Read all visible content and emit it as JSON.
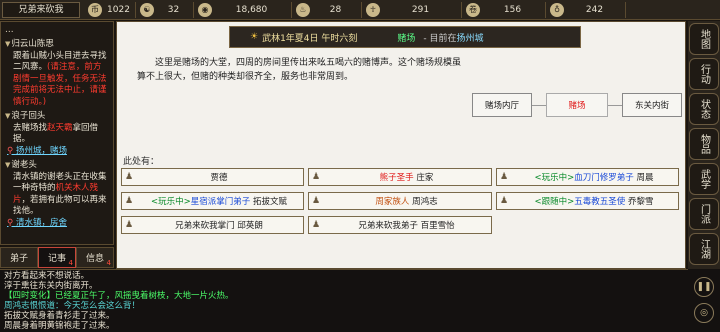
{
  "topbar": {
    "player_name": "兄弟来砍我",
    "stats": [
      {
        "icon": "coin-bag-icon",
        "glyph": "币",
        "value": "1022"
      },
      {
        "icon": "taiji-icon",
        "glyph": "☯",
        "value": "32"
      },
      {
        "icon": "copper-coin-icon",
        "glyph": "◉",
        "value": "18,680"
      },
      {
        "icon": "potion-icon",
        "glyph": "♨",
        "value": "28"
      },
      {
        "icon": "meditate-icon",
        "glyph": "☥",
        "value": "291"
      },
      {
        "icon": "scroll-icon",
        "glyph": "卷",
        "value": "156"
      },
      {
        "icon": "bottle-icon",
        "glyph": "♁",
        "value": "242"
      }
    ]
  },
  "quest_panel": {
    "header": "...",
    "quests": [
      {
        "title": "归云山陈思",
        "desc_pre": "跟着山贼小头目进去寻找二风寨。",
        "desc_red": "(请注意，前方剧情一旦触发，任务无法完成前将无法中止，请谨慎行动。)",
        "loc": ""
      },
      {
        "title": "浪子回头",
        "desc_pre": "去赌场找",
        "desc_red": "赵天霸",
        "desc_post": "拿回借据。",
        "loc": "扬州城，赌场"
      },
      {
        "title": "谢老头",
        "desc_pre": "清水镇的谢老头正在收集一种奇特的",
        "desc_red": "机关木人残片",
        "desc_post": "，若拥有此物可以再来找他。",
        "loc": "清水镇，房舍"
      }
    ]
  },
  "left_tabs": [
    {
      "label": "弟子",
      "badge": ""
    },
    {
      "label": "记事",
      "badge": "4"
    },
    {
      "label": "信息",
      "badge": "4"
    }
  ],
  "location": {
    "time": "武林1年夏4日 午时六刻",
    "place": "赌场",
    "sep": "- 目前在",
    "city": "扬州城"
  },
  "description": "这里是赌场的大堂，四周的房间里传出来吆五喝六的赌博声。这个赌场规模虽算不上很大，但赌的种类却很齐全，服务也非常周到。",
  "exits": {
    "left": "赌场内厅",
    "current": "赌场",
    "right": "东关内街"
  },
  "here_label": "此处有：",
  "npcs": [
    {
      "parts": [
        {
          "t": "贾德",
          "c": ""
        }
      ]
    },
    {
      "parts": [
        {
          "t": "熊子圣手",
          "c": "red"
        },
        {
          "t": " 庄家",
          "c": ""
        }
      ]
    },
    {
      "parts": [
        {
          "t": "<玩乐中>",
          "c": "green"
        },
        {
          "t": "血刀门修罗弟子",
          "c": "blue"
        },
        {
          "t": " 周晨",
          "c": ""
        }
      ]
    },
    {
      "parts": [
        {
          "t": "<玩乐中>",
          "c": "green"
        },
        {
          "t": "星宿派掌门弟子",
          "c": "blue"
        },
        {
          "t": " 拓拔文赋",
          "c": ""
        }
      ]
    },
    {
      "parts": [
        {
          "t": "周家族人",
          "c": "org"
        },
        {
          "t": " 周鸿志",
          "c": ""
        }
      ]
    },
    {
      "parts": [
        {
          "t": "<跟随中>",
          "c": "green"
        },
        {
          "t": "五毒教五圣使",
          "c": "blue"
        },
        {
          "t": " 乔黎雪",
          "c": ""
        }
      ]
    },
    {
      "parts": [
        {
          "t": "兄弟来砍我掌门 邱英朗",
          "c": ""
        }
      ]
    },
    {
      "parts": [
        {
          "t": "兄弟来砍我弟子 百里雪怡",
          "c": ""
        }
      ]
    }
  ],
  "side_menu": [
    "地图",
    "行动",
    "状态",
    "物品",
    "武学",
    "门派",
    "江湖"
  ],
  "log": [
    {
      "t": "对方看起来不想说话。",
      "c": "l"
    },
    {
      "t": "淳于熏往东关内街离开。",
      "c": "l"
    },
    {
      "t": "【四时变化】已经夏正午了，风摇曳着树枝，大地一片火热。",
      "c": "g"
    },
    {
      "t": "周鸿志恨恨道：今天怎么会这么背！",
      "c": "c"
    },
    {
      "t": "拓拔文赋身着青衫走了过来。",
      "c": "l"
    },
    {
      "t": "周晨身着明黄锦袍走了过来。",
      "c": "l"
    }
  ],
  "log_icons": [
    "pause-icon",
    "speed-icon"
  ]
}
